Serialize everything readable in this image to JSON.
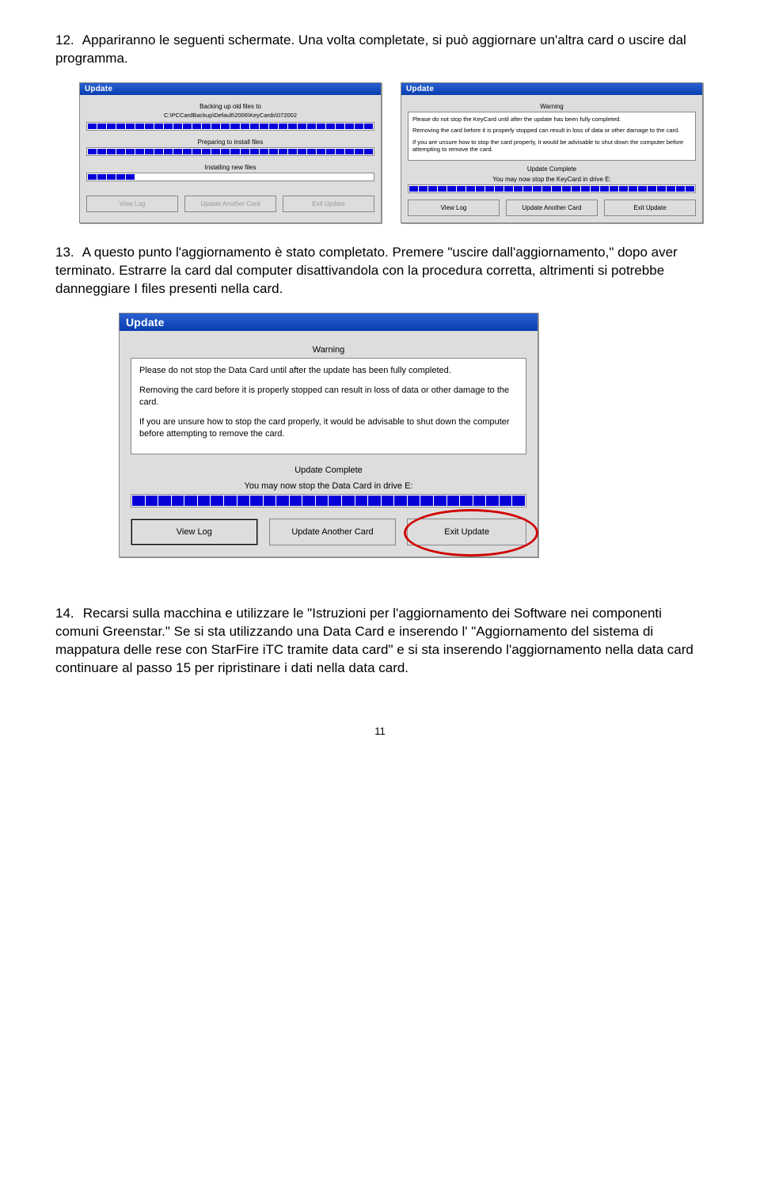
{
  "paragraphs": {
    "p12_num": "12.",
    "p12": "Appariranno le seguenti schermate.  Una volta completate, si può aggiornare un'altra card o uscire dal programma.",
    "p13_num": "13.",
    "p13": "A questo punto l'aggiornamento è stato completato. Premere \"uscire dall'aggiornamento,\" dopo aver terminato. Estrarre la card dal computer disattivandola con la procedura corretta, altrimenti si potrebbe danneggiare I files presenti nella card.",
    "p14_num": "14.",
    "p14": "Recarsi sulla macchina e utilizzare le \"Istruzioni per l'aggiornamento dei Software nei componenti comuni Greenstar.\"  Se si sta utilizzando una Data Card e inserendo l' \"Aggiornamento del sistema di mappatura delle rese con StarFire iTC tramite data card\" e si sta inserendo l'aggiornamento nella data card continuare al passo 15 per ripristinare i dati nella data card."
  },
  "dialog_left": {
    "title": "Update",
    "label1": "Backing up old files to",
    "path": "C:\\PCCardBackup\\Default\\2006\\KeyCards\\072002",
    "label2": "Preparing to install files",
    "label3": "Installing new files",
    "btn1": "View Log",
    "btn2": "Update Another Card",
    "btn3": "Exit Update"
  },
  "dialog_right": {
    "title": "Update",
    "warning_label": "Warning",
    "warn_p1": "Please do not stop the KeyCard until after the update has been fully completed.",
    "warn_p2": "Removing the card before it is properly stopped can result in loss of data or other damage to the card.",
    "warn_p3": "If you are unsure how to stop the card properly, it would be advisable to shut down the computer before attempting to remove the card.",
    "complete": "Update Complete",
    "stopmsg": "You may now stop the KeyCard in drive E:",
    "btn1": "View Log",
    "btn2": "Update Another Card",
    "btn3": "Exit Update"
  },
  "dialog_big": {
    "title": "Update",
    "warning_label": "Warning",
    "warn_p1": "Please do not stop the Data Card until after the update has been fully completed.",
    "warn_p2": "Removing the card before it is properly stopped can result in loss of data or other damage to the card.",
    "warn_p3": "If you are unsure how to stop the card properly, it would be advisable to shut down the computer before attempting to remove the card.",
    "complete": "Update Complete",
    "stopmsg": "You may now stop the Data Card in drive E:",
    "btn1": "View Log",
    "btn2": "Update Another Card",
    "btn3": "Exit Update"
  },
  "page_number": "11"
}
